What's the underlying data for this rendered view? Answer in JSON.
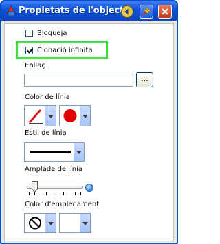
{
  "window": {
    "title": "Propietats de l'objecte"
  },
  "fields": {
    "lock_label": "Bloqueja",
    "lock_checked": false,
    "clone_label": "Clonació infinita",
    "clone_checked": true,
    "link_label": "Enllaç",
    "link_value": "",
    "browse_label": "...",
    "line_color_label": "Color de línia",
    "line_style_label": "Estil de línia",
    "line_width_label": "Amplada de línia",
    "fill_color_label": "Color d'emplenament"
  },
  "colors": {
    "line_color": "#e00000",
    "fill_color": "#ffffff",
    "title_bar": "#0a52d8",
    "highlight": "#3ee03e"
  },
  "icons": [
    "pen-icon",
    "red-dot-icon",
    "no-fill-icon",
    "help-icon",
    "pin-icon",
    "close-icon"
  ]
}
